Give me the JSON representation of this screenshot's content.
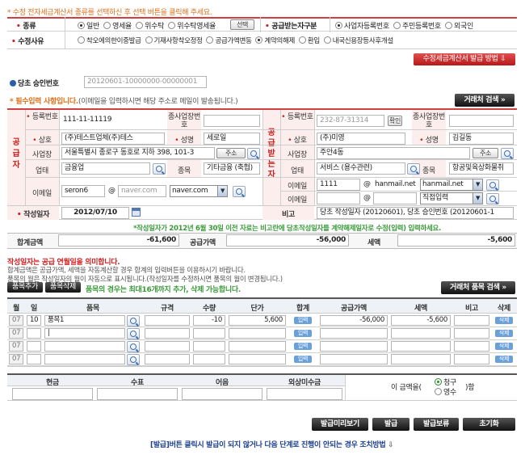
{
  "notice_top": "* 수정 전자세금계산서 종류를 선택하신 후 선택 버튼을 클릭해 주세요.",
  "type_row": {
    "label": "종류",
    "options": [
      "일반",
      "영세율",
      "위수탁",
      "위수탁영세율"
    ],
    "selected": "일반",
    "select_button": "선택",
    "recipient_label": "공급받는자구분",
    "recipient_options": [
      "사업자등록번호",
      "주민등록번호",
      "외국인"
    ],
    "recipient_selected": "사업자등록번호"
  },
  "reason_row": {
    "label": "수정사유",
    "options": [
      "착오에의한이중발급",
      "기재사항착오정정",
      "공급가액변동",
      "계약의해제",
      "환입",
      "내국신용장등사후개설"
    ],
    "selected": "계약의해제"
  },
  "revise_method_button": "수정세금계산서 발급 방법",
  "approval": {
    "label": "당초 승인번호",
    "value": "20120601-10000000-00000001"
  },
  "required_notice": "* 필수입력 사항입니다.",
  "email_notice": "(이메일을 입력하시면 해당 주소로 메일이 발송됩니다.)",
  "partner_search_button": "거래처 검색",
  "supplier": {
    "side_label": "공급자",
    "reg_no_label": "등록번호",
    "reg_no": "111-11-11119",
    "sub_reg_label": "종사업장번호",
    "name_label": "상호",
    "name": "(주)테스트업체(주)테스",
    "ceo_label": "성명",
    "ceo": "세로일",
    "address_label": "사업장",
    "address": "서울특별시 종로구 동호로 지하 398, 101-3",
    "address_button": "주소",
    "biz_type_label": "업태",
    "biz_type": "금융업",
    "biz_item_label": "종목",
    "biz_item": "기타금융 (축협)",
    "email_label": "이메일",
    "email_id": "seron6",
    "email_domain": "naver.com",
    "email_select": "naver.com"
  },
  "receiver": {
    "side_label": "공급받는자",
    "reg_no_label": "등록번호",
    "reg_no": "232-87-31314",
    "confirm_button": "확인",
    "sub_reg_label": "종사업장번호",
    "name_label": "상호",
    "name": "(주)미영",
    "ceo_label": "성명",
    "ceo": "김길동",
    "address_label": "사업장",
    "address": "주안4동",
    "address_button": "주소",
    "biz_type_label": "업태",
    "biz_type": "서비스 (용수관련)",
    "biz_item_label": "종목",
    "biz_item": "항공및육상화물취",
    "email1_label": "이메일",
    "email1_id": "1111",
    "email1_domain": "hanmail.net",
    "email1_select": "hanmail.net",
    "email2_label": "이메일",
    "email2_select": "직접입력"
  },
  "write_date": {
    "label": "작성일자",
    "value": "2012/07/10"
  },
  "remarks": {
    "label": "비고",
    "value": "당초 작성일자 (20120601), 당초 승인번호 (20120601-1"
  },
  "date_notice": "*작성일자가 2012년 6월 30일 이전 자료는 비고란에 당초작성일자를 계약해제일자로 수정(입력) 입력하세요.",
  "totals": {
    "total_label": "합계금액",
    "total": "-61,600",
    "supply_label": "공급가액",
    "supply": "-56,000",
    "tax_label": "세액",
    "tax": "-5,600"
  },
  "write_date_notice": "작성일자는 공급 연월일을 의미합니다.",
  "info_lines": [
    "합계금액은 공급가액, 세액을 자동계산할 경우 합계의 입력버튼을 이용하시기 바랍니다.",
    "품목의 월은 작성일자의 월이 자동으로 표시됩니다.(작성일자를 수정하시면 품목의 월이 변경됩니다.)"
  ],
  "item_buttons": {
    "add": "품목추가",
    "delete": "품목삭제"
  },
  "item_notice": "품목의 경우는 최대16개까지 추가, 삭제 가능합니다.",
  "item_search_button": "거래처 품목 검색",
  "item_headers": [
    "월",
    "일",
    "품목",
    "규격",
    "수량",
    "단가",
    "합계",
    "공급가액",
    "세액",
    "비고",
    "삭제"
  ],
  "items": [
    {
      "month": "07",
      "day": "10",
      "name": "품목1",
      "spec": "",
      "qty": "-10",
      "price": "5,600",
      "sum": "입력",
      "supply": "-56,000",
      "tax": "-5,600",
      "note": "",
      "del": "삭제"
    },
    {
      "month": "07",
      "day": "",
      "name": "|",
      "spec": "",
      "qty": "",
      "price": "",
      "sum": "입력",
      "supply": "",
      "tax": "",
      "note": "",
      "del": "삭제"
    },
    {
      "month": "07",
      "day": "",
      "name": "",
      "spec": "",
      "qty": "",
      "price": "",
      "sum": "입력",
      "supply": "",
      "tax": "",
      "note": "",
      "del": "삭제"
    },
    {
      "month": "07",
      "day": "",
      "name": "",
      "spec": "",
      "qty": "",
      "price": "",
      "sum": "입력",
      "supply": "",
      "tax": "",
      "note": "",
      "del": "삭제"
    }
  ],
  "payment_headers": [
    "현금",
    "수표",
    "어음",
    "외상미수금"
  ],
  "amount_text_pre": "이 금액을",
  "amount_text_post": "함",
  "claim_options": [
    "청구",
    "영수"
  ],
  "claim_selected": "청구",
  "bottom_buttons": [
    "발급미리보기",
    "발급",
    "발급보류",
    "초기화"
  ],
  "bottom_notice": "[발급]버튼 클릭시 발급이 되지 않거나 다음 단계로 진행이 안되는 경우 조치방법"
}
